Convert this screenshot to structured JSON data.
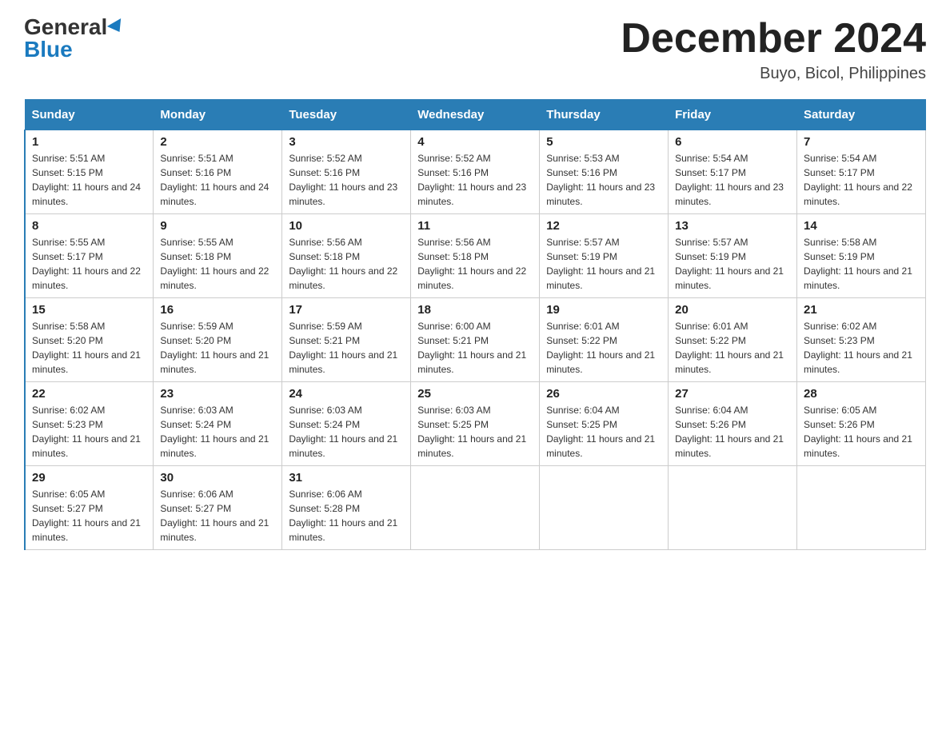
{
  "header": {
    "logo_general": "General",
    "logo_blue": "Blue",
    "month_title": "December 2024",
    "location": "Buyo, Bicol, Philippines"
  },
  "days_of_week": [
    "Sunday",
    "Monday",
    "Tuesday",
    "Wednesday",
    "Thursday",
    "Friday",
    "Saturday"
  ],
  "weeks": [
    [
      {
        "day": "1",
        "sunrise": "5:51 AM",
        "sunset": "5:15 PM",
        "daylight": "11 hours and 24 minutes."
      },
      {
        "day": "2",
        "sunrise": "5:51 AM",
        "sunset": "5:16 PM",
        "daylight": "11 hours and 24 minutes."
      },
      {
        "day": "3",
        "sunrise": "5:52 AM",
        "sunset": "5:16 PM",
        "daylight": "11 hours and 23 minutes."
      },
      {
        "day": "4",
        "sunrise": "5:52 AM",
        "sunset": "5:16 PM",
        "daylight": "11 hours and 23 minutes."
      },
      {
        "day": "5",
        "sunrise": "5:53 AM",
        "sunset": "5:16 PM",
        "daylight": "11 hours and 23 minutes."
      },
      {
        "day": "6",
        "sunrise": "5:54 AM",
        "sunset": "5:17 PM",
        "daylight": "11 hours and 23 minutes."
      },
      {
        "day": "7",
        "sunrise": "5:54 AM",
        "sunset": "5:17 PM",
        "daylight": "11 hours and 22 minutes."
      }
    ],
    [
      {
        "day": "8",
        "sunrise": "5:55 AM",
        "sunset": "5:17 PM",
        "daylight": "11 hours and 22 minutes."
      },
      {
        "day": "9",
        "sunrise": "5:55 AM",
        "sunset": "5:18 PM",
        "daylight": "11 hours and 22 minutes."
      },
      {
        "day": "10",
        "sunrise": "5:56 AM",
        "sunset": "5:18 PM",
        "daylight": "11 hours and 22 minutes."
      },
      {
        "day": "11",
        "sunrise": "5:56 AM",
        "sunset": "5:18 PM",
        "daylight": "11 hours and 22 minutes."
      },
      {
        "day": "12",
        "sunrise": "5:57 AM",
        "sunset": "5:19 PM",
        "daylight": "11 hours and 21 minutes."
      },
      {
        "day": "13",
        "sunrise": "5:57 AM",
        "sunset": "5:19 PM",
        "daylight": "11 hours and 21 minutes."
      },
      {
        "day": "14",
        "sunrise": "5:58 AM",
        "sunset": "5:19 PM",
        "daylight": "11 hours and 21 minutes."
      }
    ],
    [
      {
        "day": "15",
        "sunrise": "5:58 AM",
        "sunset": "5:20 PM",
        "daylight": "11 hours and 21 minutes."
      },
      {
        "day": "16",
        "sunrise": "5:59 AM",
        "sunset": "5:20 PM",
        "daylight": "11 hours and 21 minutes."
      },
      {
        "day": "17",
        "sunrise": "5:59 AM",
        "sunset": "5:21 PM",
        "daylight": "11 hours and 21 minutes."
      },
      {
        "day": "18",
        "sunrise": "6:00 AM",
        "sunset": "5:21 PM",
        "daylight": "11 hours and 21 minutes."
      },
      {
        "day": "19",
        "sunrise": "6:01 AM",
        "sunset": "5:22 PM",
        "daylight": "11 hours and 21 minutes."
      },
      {
        "day": "20",
        "sunrise": "6:01 AM",
        "sunset": "5:22 PM",
        "daylight": "11 hours and 21 minutes."
      },
      {
        "day": "21",
        "sunrise": "6:02 AM",
        "sunset": "5:23 PM",
        "daylight": "11 hours and 21 minutes."
      }
    ],
    [
      {
        "day": "22",
        "sunrise": "6:02 AM",
        "sunset": "5:23 PM",
        "daylight": "11 hours and 21 minutes."
      },
      {
        "day": "23",
        "sunrise": "6:03 AM",
        "sunset": "5:24 PM",
        "daylight": "11 hours and 21 minutes."
      },
      {
        "day": "24",
        "sunrise": "6:03 AM",
        "sunset": "5:24 PM",
        "daylight": "11 hours and 21 minutes."
      },
      {
        "day": "25",
        "sunrise": "6:03 AM",
        "sunset": "5:25 PM",
        "daylight": "11 hours and 21 minutes."
      },
      {
        "day": "26",
        "sunrise": "6:04 AM",
        "sunset": "5:25 PM",
        "daylight": "11 hours and 21 minutes."
      },
      {
        "day": "27",
        "sunrise": "6:04 AM",
        "sunset": "5:26 PM",
        "daylight": "11 hours and 21 minutes."
      },
      {
        "day": "28",
        "sunrise": "6:05 AM",
        "sunset": "5:26 PM",
        "daylight": "11 hours and 21 minutes."
      }
    ],
    [
      {
        "day": "29",
        "sunrise": "6:05 AM",
        "sunset": "5:27 PM",
        "daylight": "11 hours and 21 minutes."
      },
      {
        "day": "30",
        "sunrise": "6:06 AM",
        "sunset": "5:27 PM",
        "daylight": "11 hours and 21 minutes."
      },
      {
        "day": "31",
        "sunrise": "6:06 AM",
        "sunset": "5:28 PM",
        "daylight": "11 hours and 21 minutes."
      },
      null,
      null,
      null,
      null
    ]
  ]
}
